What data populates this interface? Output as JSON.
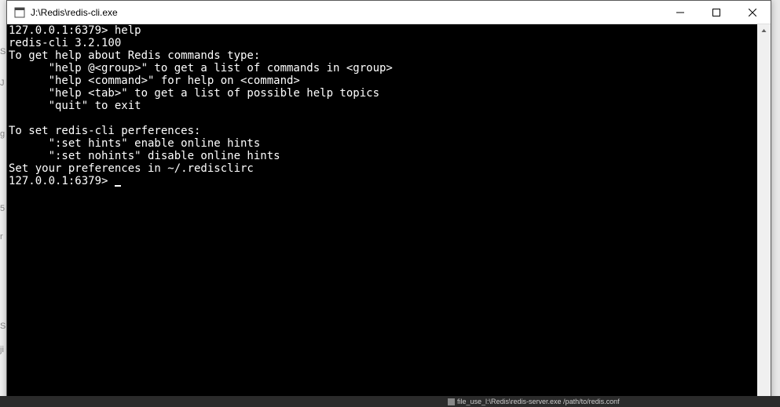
{
  "window": {
    "title": "J:\\Redis\\redis-cli.exe"
  },
  "console": {
    "lines": [
      "127.0.0.1:6379> help",
      "redis-cli 3.2.100",
      "To get help about Redis commands type:",
      "      \"help @<group>\" to get a list of commands in <group>",
      "      \"help <command>\" for help on <command>",
      "      \"help <tab>\" to get a list of possible help topics",
      "      \"quit\" to exit",
      "",
      "To set redis-cli perferences:",
      "      \":set hints\" enable online hints",
      "      \":set nohints\" disable online hints",
      "Set your preferences in ~/.redisclirc",
      "127.0.0.1:6379> "
    ]
  },
  "taskbar": {
    "item": "file_use_l:\\Redis\\redis-server.exe /path/to/redis.conf"
  },
  "left_edge": {
    "chars": [
      "S",
      "J",
      "g",
      "5",
      "r",
      "S",
      "ji"
    ]
  }
}
